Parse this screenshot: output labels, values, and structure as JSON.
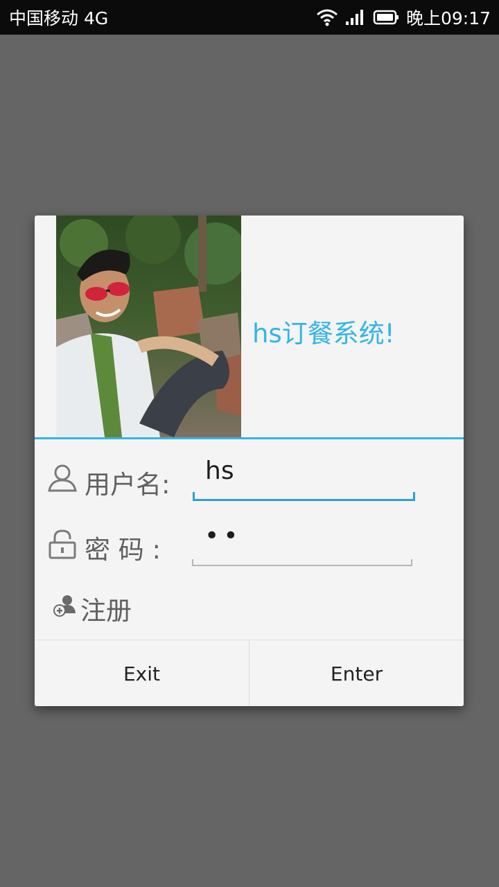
{
  "status_bar": {
    "carrier": "中国移动 4G",
    "time": "晚上09:17",
    "icons": [
      "wifi-icon",
      "signal-icon",
      "battery-icon"
    ]
  },
  "dialog": {
    "title": "hs订餐系统!",
    "username": {
      "label": "用户名:",
      "value": "hs",
      "icon": "user-icon"
    },
    "password": {
      "label": "密  码 :",
      "value": "••",
      "icon": "lock-icon"
    },
    "register_label": "注册",
    "buttons": {
      "exit": "Exit",
      "enter": "Enter"
    }
  },
  "colors": {
    "accent": "#33b5e5",
    "dim_background": "#656565",
    "dialog_background": "#f4f4f4"
  }
}
